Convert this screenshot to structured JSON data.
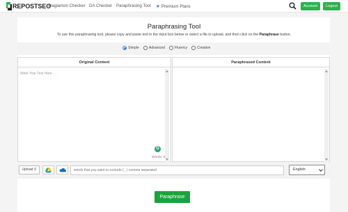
{
  "brand": {
    "logo_text": "REPOSTSEO"
  },
  "nav": {
    "links": [
      "Plagiarism Checker",
      "DA Checker",
      "Paraphrasing Tool"
    ],
    "premium": "Premium Plans",
    "account": "Account",
    "logout": "Logout"
  },
  "page": {
    "title": "Paraphrasing Tool",
    "subtitle_pre": "To use this paraphrasing tool, please copy and paste text in the input box below or select a file to upload, and then click on the ",
    "subtitle_bold": "Paraphrase",
    "subtitle_post": " button."
  },
  "modes": {
    "options": [
      "Simple",
      "Advanced",
      "Fluency",
      "Creative"
    ],
    "selected": "Simple"
  },
  "panels": {
    "original_header": "Original Content",
    "paraphrased_header": "Paraphrased Content",
    "input_placeholder": "Write Your Text Here . . .",
    "words_label": "Words: 0"
  },
  "toolbar": {
    "upload_label": "Upload",
    "exclude_placeholder": "words that you want to exclude ( , ) comma separated",
    "language": "English"
  },
  "actions": {
    "paraphrase_label": "Paraphrase"
  },
  "colors": {
    "accent_green": "#2bb24c",
    "primary_button": "#18a53c",
    "radio_blue": "#3b78d6"
  }
}
